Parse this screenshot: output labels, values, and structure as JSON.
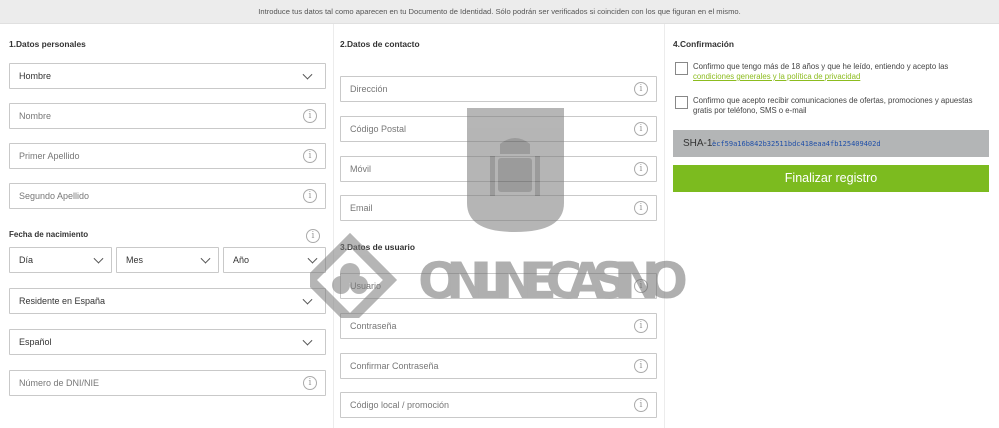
{
  "notice": "Introduce tus datos tal como aparecen en tu Documento de Identidad. Sólo podrán ser verificados si coinciden con los que figuran en el mismo.",
  "section1": {
    "title": "1.Datos personales",
    "gender": "Hombre",
    "name_placeholder": "Nombre",
    "surname1_placeholder": "Primer Apellido",
    "surname2_placeholder": "Segundo Apellido",
    "birth_label": "Fecha de nacimiento",
    "day": "Día",
    "month": "Mes",
    "year": "Año",
    "residence": "Residente en España",
    "nationality": "Español",
    "dni_placeholder": "Número de DNI/NIE"
  },
  "section2": {
    "title": "2.Datos de contacto",
    "address_placeholder": "Dirección",
    "postal_placeholder": "Código Postal",
    "mobile_placeholder": "Móvil",
    "email_placeholder": "Email"
  },
  "section3": {
    "title": "3.Datos de usuario",
    "user_placeholder": "Usuario",
    "password_placeholder": "Contraseña",
    "confirm_placeholder": "Confirmar Contraseña",
    "promo_placeholder": "Código local / promoción"
  },
  "section4": {
    "title": "4.Confirmación",
    "check1_text": "Confirmo que tengo más de 18 años y que he leído, entiendo y acepto las",
    "check1_link": "condiciones generales y la política de privacidad",
    "check2_text": "Confirmo que acepto recibir comunicaciones de ofertas, promociones y apuestas gratis por teléfono, SMS o e-mail",
    "sha_label": "SHA-1:",
    "sha_value": "ecf59a16b842b32511bdc418eaa4fb125409402d",
    "submit_label": "Finalizar registro"
  },
  "icons": {
    "info": "info-icon",
    "chevron": "chevron-down-icon"
  },
  "watermark": {
    "text": "ONLINE CASINO"
  },
  "colors": {
    "accent": "#7cbb1f",
    "link": "#8cbc1f",
    "sha_bg": "#b3b5b6",
    "notice_bg": "#ececec"
  }
}
